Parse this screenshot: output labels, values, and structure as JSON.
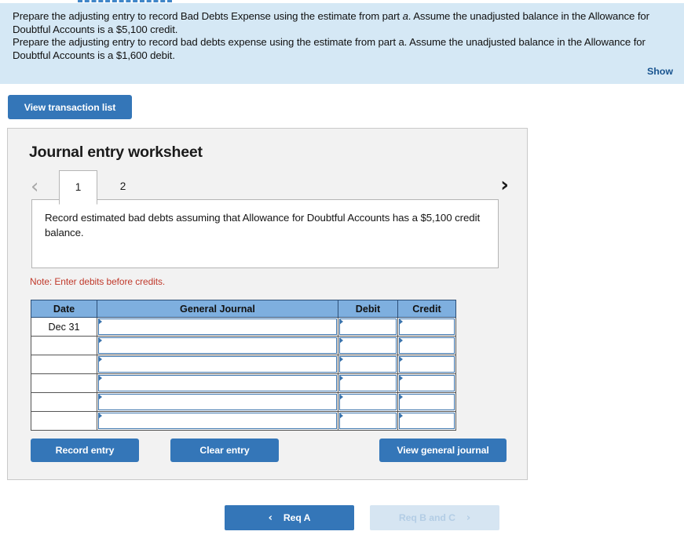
{
  "prompt": {
    "line1_pre": "Prepare the adjusting entry to record Bad Debts Expense using the estimate from part ",
    "line1_em": "a",
    "line1_post": ". Assume the unadjusted balance in the Allowance for Doubtful Accounts is a $5,100 credit.",
    "line2": "Prepare the adjusting entry to record bad debts expense using the estimate from part a. Assume the unadjusted balance in the Allowance for Doubtful Accounts is a $1,600 debit.",
    "show_label": "Show"
  },
  "toolbar": {
    "view_transaction_list": "View transaction list"
  },
  "worksheet": {
    "title": "Journal entry worksheet",
    "tabs": [
      {
        "label": "1",
        "active": true
      },
      {
        "label": "2",
        "active": false
      }
    ],
    "prev_arrow": "‹",
    "next_arrow": "›",
    "entry_prompt": "Record estimated bad debts assuming that Allowance for Doubtful Accounts has a $5,100 credit balance.",
    "note": "Note: Enter debits before credits.",
    "table": {
      "headers": [
        "Date",
        "General Journal",
        "Debit",
        "Credit"
      ],
      "rows": [
        {
          "date": "Dec 31",
          "general_journal": "",
          "debit": "",
          "credit": ""
        },
        {
          "date": "",
          "general_journal": "",
          "debit": "",
          "credit": ""
        },
        {
          "date": "",
          "general_journal": "",
          "debit": "",
          "credit": ""
        },
        {
          "date": "",
          "general_journal": "",
          "debit": "",
          "credit": ""
        },
        {
          "date": "",
          "general_journal": "",
          "debit": "",
          "credit": ""
        },
        {
          "date": "",
          "general_journal": "",
          "debit": "",
          "credit": ""
        }
      ]
    },
    "buttons": {
      "record_entry": "Record entry",
      "clear_entry": "Clear entry",
      "view_general_journal": "View general journal"
    }
  },
  "footer_nav": {
    "prev_label": "Req A",
    "prev_chevron": "‹",
    "next_label": "Req B and C",
    "next_chevron": "›"
  },
  "colors": {
    "accent_blue": "#3476b8",
    "banner_blue": "#d5e8f5",
    "table_header_blue": "#7eafdf",
    "note_red": "#c0392b",
    "link_blue": "#19548f",
    "disabled_blue": "#d6e5f2"
  }
}
